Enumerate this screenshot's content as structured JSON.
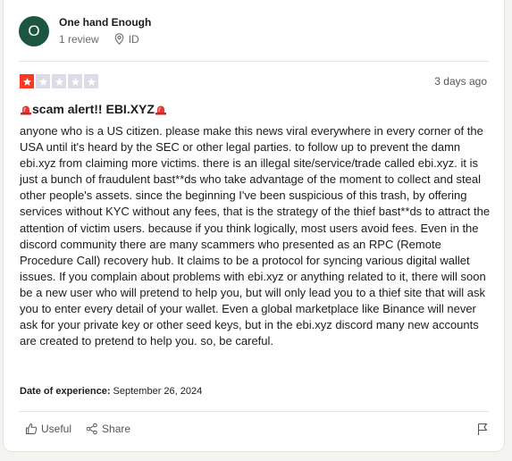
{
  "reviewer": {
    "avatar_initial": "O",
    "avatar_color": "#1d5640",
    "name": "One hand Enough",
    "review_count": "1 review",
    "location": "ID"
  },
  "review": {
    "rating": 1,
    "rating_max": 5,
    "star_filled_color": "#ff3722",
    "star_empty_color": "#dcdce6",
    "date": "3 days ago",
    "title": "scam alert!! EBI.XYZ",
    "title_icon": "police-siren-emoji",
    "body": "anyone who is a US citizen. please make this news viral everywhere in every corner of the USA until it's heard by the SEC or other legal parties. to follow up to prevent the damn ebi.xyz from claiming more victims. there is an illegal site/service/trade called ebi.xyz. it is just a bunch of fraudulent bast**ds who take advantage of the moment to collect and steal other people's assets. since the beginning I've been suspicious of this trash, by offering services without KYC without any fees, that is the strategy of the thief bast**ds to attract the attention of victim users. because if you think logically, most users avoid fees. Even in the discord community there are many scammers who presented as an RPC (Remote Procedure Call) recovery hub. It claims to be a protocol for syncing various digital wallet issues. If you complain about problems with ebi.xyz or anything related to it, there will soon be a new user who will pretend to help you, but will only lead you to a thief site that will ask you to enter every detail of your wallet. Even a global marketplace like Binance will never ask for your private key or other seed keys, but in the ebi.xyz discord many new accounts are created to pretend to help you. so, be careful.",
    "experience_label": "Date of experience:",
    "experience_date": "September 26, 2024"
  },
  "actions": {
    "useful_label": "Useful",
    "share_label": "Share",
    "flag_icon": "flag-icon"
  }
}
